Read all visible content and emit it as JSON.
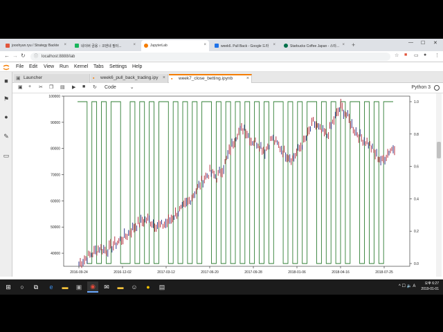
{
  "browser": {
    "tabs": [
      {
        "label": "jooohyun.ryu / Strategy Backte",
        "color": "#e2553b"
      },
      {
        "label": "네이버 금융 :: 코덴네 필터...",
        "color": "#19b55b"
      },
      {
        "label": "JupyterLab",
        "color": "#f57c00"
      },
      {
        "label": "week6. Pull Back - Google 드라",
        "color": "#1f73e8"
      },
      {
        "label": "Starbucks Coffee Japan - 스타...",
        "color": "#00704a"
      }
    ],
    "active_tab": 2,
    "new_tab": "+",
    "url": "localhost:8888/lab",
    "min": "—",
    "max": "☐",
    "close": "✕"
  },
  "menu": [
    "File",
    "Edit",
    "View",
    "Run",
    "Kernel",
    "Tabs",
    "Settings",
    "Help"
  ],
  "doc_tabs": [
    {
      "label": "Launcher",
      "icon": "launcher-icon"
    },
    {
      "label": "week6_pull_back_trading.ipy",
      "icon": "notebook-icon"
    },
    {
      "label": "week7_close_betting.ipynb",
      "icon": "notebook-icon"
    }
  ],
  "active_doc_tab": 2,
  "toolbar": {
    "cell_type": "Code",
    "kernel": "Python 3"
  },
  "chart_data": {
    "type": "line",
    "left_axis": {
      "ticks": [
        40000,
        50000,
        60000,
        70000,
        80000,
        90000,
        100000
      ],
      "ylim": [
        35000,
        100000
      ]
    },
    "right_axis": {
      "ticks": [
        "0.0",
        "0.2",
        "0.4",
        "0.6",
        "0.8",
        "1.0"
      ],
      "ylim": [
        0,
        1
      ]
    },
    "x_ticks": [
      "2016-09-24",
      "2016-12-02",
      "2017-03-12",
      "2017-06-20",
      "2017-09-28",
      "2018-01-06",
      "2018-04-16",
      "2018-07-25"
    ],
    "series": [
      {
        "color": "#b01c2e",
        "values": [
          36000,
          38000,
          40000,
          42000,
          41000,
          43000,
          45000,
          47000,
          50000,
          52000,
          53000,
          51000,
          50500,
          52000,
          55000,
          57000,
          60000,
          64000,
          68000,
          71000,
          69000,
          73000,
          80000,
          86000,
          88000,
          83000,
          82000,
          79000,
          84000,
          81000,
          78000,
          76000,
          80000,
          84000,
          90000,
          87000,
          85000,
          91000,
          96000,
          92000,
          87000,
          84000,
          82000,
          78000,
          75000,
          79000,
          81000
        ]
      },
      {
        "color": "#2e7d32",
        "signal": [
          1,
          1,
          0,
          1,
          0,
          1,
          0,
          1,
          1,
          0,
          0,
          1,
          0,
          1,
          0,
          1,
          0,
          1,
          1,
          0,
          1,
          0,
          1,
          0,
          1,
          0,
          1,
          1,
          0,
          1,
          0,
          1,
          0,
          1,
          0,
          1,
          0,
          1,
          0,
          1,
          0,
          1,
          1,
          0,
          1,
          0,
          1,
          0,
          1,
          1,
          0,
          1,
          0,
          1,
          0,
          1,
          0,
          1,
          1,
          0,
          1,
          0,
          1,
          0,
          1,
          1
        ]
      }
    ]
  },
  "taskbar": {
    "tray": "^ ☐ 🔈 A",
    "time": "오후 6:27",
    "date": "2019-01-01"
  }
}
